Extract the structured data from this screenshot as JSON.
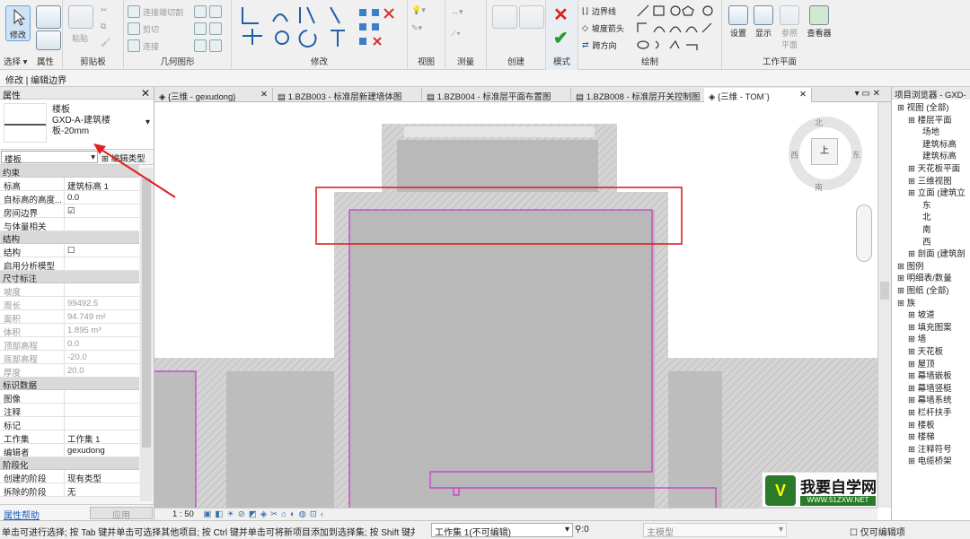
{
  "ribbon": {
    "groups": [
      {
        "label": "选择",
        "buttons": [
          "修改"
        ]
      },
      {
        "label": "属性"
      },
      {
        "label": "剪贴板",
        "buttons": [
          "粘贴"
        ]
      },
      {
        "label": "几何图形",
        "buttons": [
          "连接端切割",
          "剪切",
          "连接"
        ]
      },
      {
        "label": "修改"
      },
      {
        "label": "视图"
      },
      {
        "label": "测量"
      },
      {
        "label": "创建"
      },
      {
        "label": "模式"
      },
      {
        "label": "绘制",
        "buttons": [
          "边界线",
          "坡度箭头",
          "跨方向"
        ]
      },
      {
        "label": "工作平面",
        "buttons": [
          "设置",
          "显示",
          "参照平面",
          "查看器"
        ]
      }
    ]
  },
  "context_bar": "修改 | 编辑边界",
  "properties": {
    "title": "属性",
    "type_family": "楼板",
    "type_name": "GXD-A-建筑楼板-20mm",
    "instance_filter": "楼板",
    "edit_type": "编辑类型",
    "categories": [
      {
        "name": "约束",
        "rows": [
          [
            "标高",
            "建筑标高 1"
          ],
          [
            "自标高的高度...",
            "0.0"
          ],
          [
            "房间边界",
            "☑"
          ],
          [
            "与体量相关",
            ""
          ]
        ]
      },
      {
        "name": "结构",
        "rows": [
          [
            "结构",
            "☐"
          ],
          [
            "启用分析模型",
            ""
          ]
        ]
      },
      {
        "name": "尺寸标注",
        "rows": [
          [
            "坡度",
            ""
          ],
          [
            "周长",
            "99492.5"
          ],
          [
            "面积",
            "94.749 m²"
          ],
          [
            "体积",
            "1.895 m³"
          ],
          [
            "顶部高程",
            "0.0"
          ],
          [
            "底部高程",
            "-20.0"
          ],
          [
            "厚度",
            "20.0"
          ]
        ]
      },
      {
        "name": "标识数据",
        "rows": [
          [
            "图像",
            ""
          ],
          [
            "注释",
            ""
          ],
          [
            "标记",
            ""
          ],
          [
            "工作集",
            "工作集 1"
          ],
          [
            "编辑者",
            "gexudong"
          ]
        ]
      },
      {
        "name": "阶段化",
        "rows": [
          [
            "创建的阶段",
            "现有类型"
          ],
          [
            "拆除的阶段",
            "无"
          ]
        ]
      }
    ],
    "help_link": "属性帮助",
    "apply": "应用"
  },
  "tabs": [
    "{三维 - gexudong}",
    "1.BZB003 - 标准层新建墙体图",
    "1.BZB004 - 标准层平面布置图",
    "1.BZB008 - 标准层开关控制图",
    "{三维 - TOM`}"
  ],
  "viewcube": {
    "north": "北",
    "south": "南",
    "east": "东",
    "west": "西",
    "face": "上"
  },
  "view_scale": "1 : 50",
  "browser": {
    "title": "项目浏览器 - GXD-",
    "items": [
      "视图 (全部)",
      "楼层平面",
      "场地",
      "建筑标高",
      "建筑标高",
      "天花板平面",
      "三维视图",
      "立面 (建筑立",
      "东",
      "北",
      "南",
      "西",
      "剖面 (建筑剖",
      "图例",
      "明细表/数量",
      "图纸 (全部)",
      "族",
      "坡道",
      "填充图案",
      "墙",
      "天花板",
      "屋顶",
      "幕墙嵌板",
      "幕墙竖梃",
      "幕墙系统",
      "栏杆扶手",
      "楼板",
      "楼梯",
      "注释符号",
      "电缆桥架"
    ]
  },
  "status": {
    "hint": "单击可进行选择; 按 Tab 键并单击可选择其他项目; 按 Ctrl 键并单击可将新项目添加到选择集; 按 Shift 键并单击可",
    "selected_count": ":0",
    "workset": "工作集 1(不可编辑)",
    "model": "主模型",
    "editable_only": "仅可编辑项"
  },
  "watermark": {
    "brand": "我要自学网",
    "url": "WWW.51ZXW.NET"
  },
  "colors": {
    "highlight": "#e02020",
    "boundary": "#cc33cc",
    "floor": "#b9b9b9"
  }
}
